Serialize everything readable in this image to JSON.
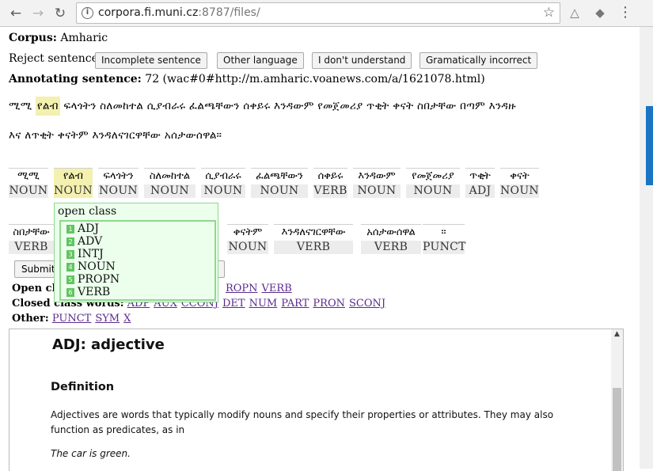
{
  "browser": {
    "url_host": "corpora.fi.muni.cz",
    "url_rest": ":8787/files/"
  },
  "corpus": {
    "label": "Corpus:",
    "value": "Amharic"
  },
  "reject": {
    "label": "Reject sentence:",
    "buttons": [
      "Incomplete sentence",
      "Other language",
      "I don't understand",
      "Gramatically incorrect"
    ]
  },
  "annotating": {
    "label": "Annotating sentence:",
    "value": "72 (wac#0#http://m.amharic.voanews.com/a/1621078.html)"
  },
  "sentence": {
    "first_word": "ሚሚ",
    "highlighted": "የልብ",
    "line1_rest": "ፍላጎትን ስለመከተል ሲያብራሩ ፈልጫቸውን ሰቀይሩ እንዳውም የመጀመሪያ ጥቂት ቀናት ስበታቸው በጣም እንዳዙ",
    "line2": "እና ለጥቂት ቀናትም እንዳለናገርዋቸው አሰታውሰዋል።"
  },
  "tokens_row1": [
    {
      "word": "ሚሚ",
      "pos": "NOUN"
    },
    {
      "word": "የልብ",
      "pos": "NOUN"
    },
    {
      "word": "ፍላጎትን",
      "pos": "NOUN"
    },
    {
      "word": "ስለመከተል",
      "pos": "NOUN"
    },
    {
      "word": "ሲያብራሩ",
      "pos": "NOUN"
    },
    {
      "word": "ፈልጫቸውን",
      "pos": "NOUN"
    },
    {
      "word": "ሰቀይሩ",
      "pos": "VERB"
    },
    {
      "word": "እንዳውም",
      "pos": "NOUN"
    },
    {
      "word": "የመጀመሪያ",
      "pos": "NOUN"
    },
    {
      "word": "ጥቂት",
      "pos": "ADJ"
    },
    {
      "word": "ቀናት",
      "pos": "NOUN"
    }
  ],
  "tokens_row2": [
    {
      "word": "ስበታቸው",
      "pos": "VERB"
    },
    {
      "word": "ቀናትም",
      "pos": "NOUN"
    },
    {
      "word": "እንዳለናገርዋቸው",
      "pos": "VERB"
    },
    {
      "word": "አሰታውሰዋል",
      "pos": "VERB"
    },
    {
      "word": "።",
      "pos": "PUNCT"
    }
  ],
  "popup": {
    "title": "open class",
    "items": [
      {
        "num": "1",
        "label": "ADJ"
      },
      {
        "num": "2",
        "label": "ADV"
      },
      {
        "num": "3",
        "label": "INTJ"
      },
      {
        "num": "4",
        "label": "NOUN"
      },
      {
        "num": "5",
        "label": "PROPN"
      },
      {
        "num": "6",
        "label": "VERB"
      }
    ]
  },
  "submit": {
    "label": "Submit"
  },
  "open_class": {
    "label": "Open cla",
    "visible_tags": [
      "ROPN",
      "VERB"
    ]
  },
  "closed_class": {
    "label": "Closed class words:",
    "tags": [
      "ADP",
      "AUX",
      "CCONJ",
      "DET",
      "NUM",
      "PART",
      "PRON",
      "SCONJ"
    ]
  },
  "other": {
    "label": "Other:",
    "tags": [
      "PUNCT",
      "SYM",
      "X"
    ]
  },
  "doc": {
    "heading": "ADJ: adjective",
    "section": "Definition",
    "paragraph": "Adjectives are words that typically modify nouns and specify their properties or attributes. They may also function as predicates, as in",
    "example": "The car is green."
  },
  "colors": {
    "highlight": "#f3f0b0",
    "popup_bg": "#ecffec",
    "popup_border": "#8fd88f",
    "link": "#5b2a8c"
  }
}
